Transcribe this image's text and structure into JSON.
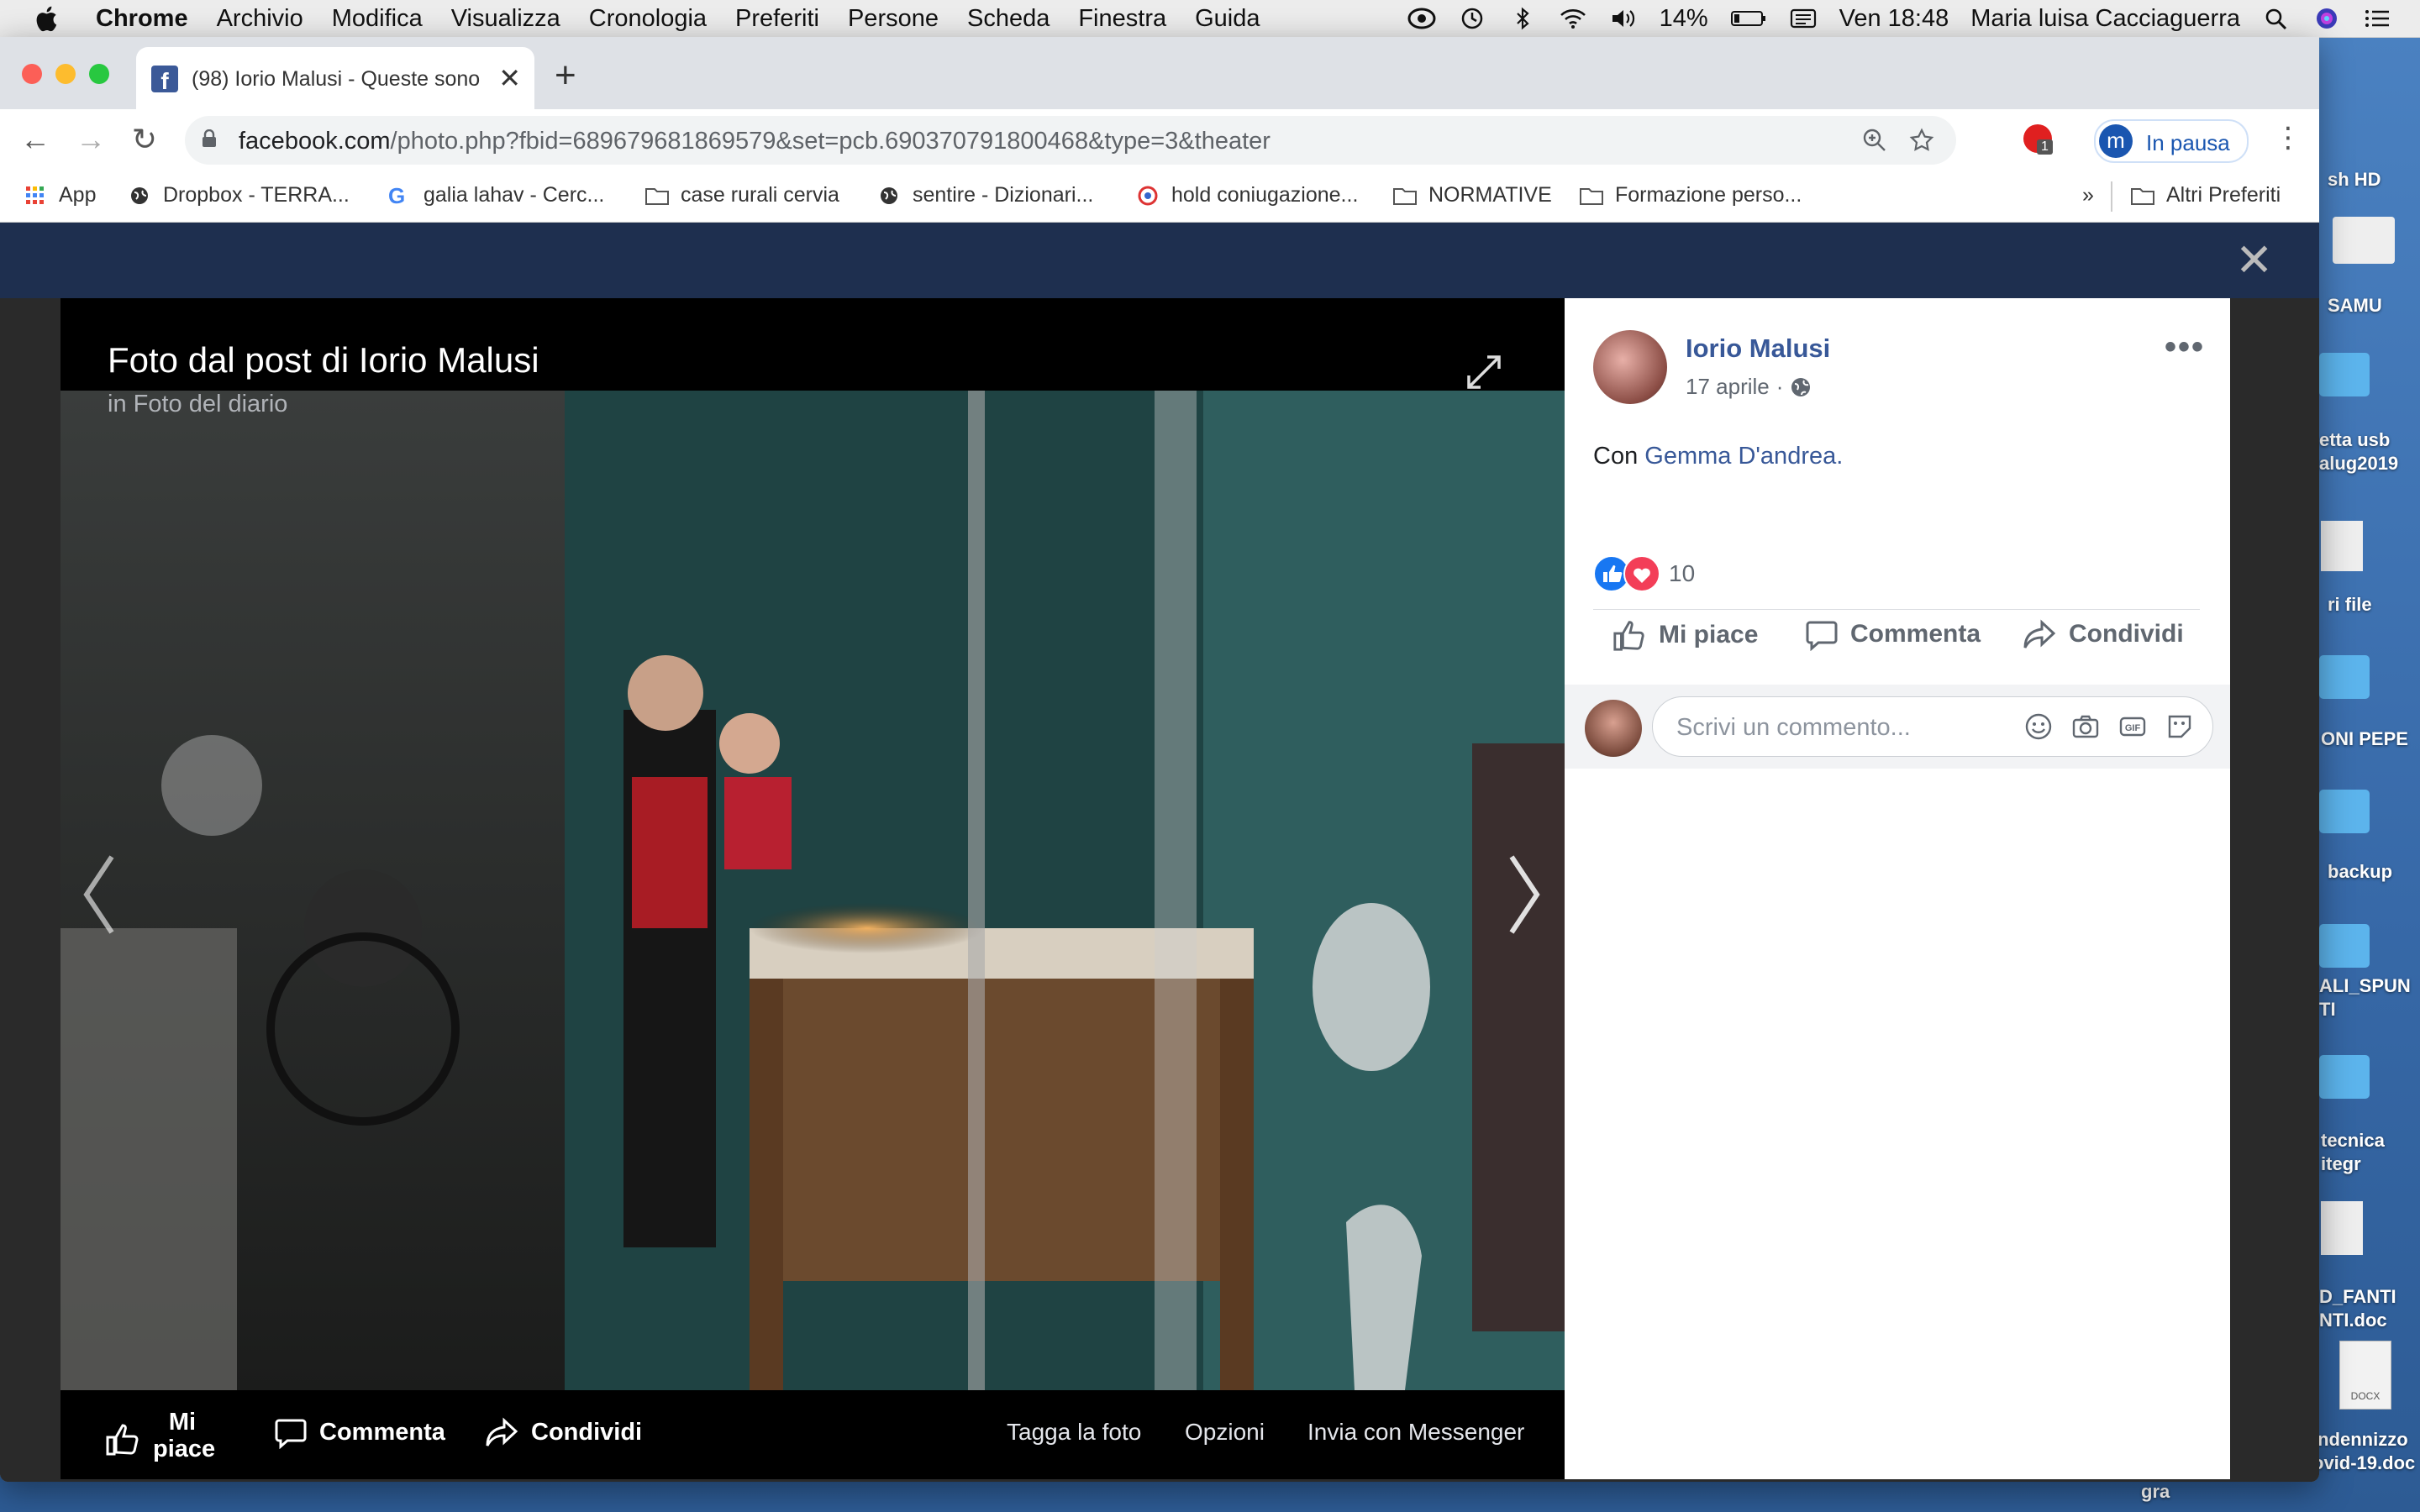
{
  "menubar": {
    "app": "Chrome",
    "items": [
      "Archivio",
      "Modifica",
      "Visualizza",
      "Cronologia",
      "Preferiti",
      "Persone",
      "Scheda",
      "Finestra",
      "Guida"
    ],
    "battery": "14%",
    "clock": "Ven 18:48",
    "user": "Maria luisa Cacciaguerra"
  },
  "desktop": {
    "icons": [
      "sh HD",
      "SAMU",
      "etta usb\nalug2019",
      "ri file",
      "ONI PEPE",
      "backup",
      "ALI_SPUN\nTI",
      "tecnica\nitegr",
      "D_FANTI\nNTI.doc",
      "Indennizzo\novid-19.doc"
    ],
    "bottom_text": "gra"
  },
  "browser": {
    "tab_title": "(98) Iorio Malusi - Queste sono",
    "url_host": "facebook.com",
    "url_path": "/photo.php?fbid=689679681869579&set=pcb.690370791800468&type=3&theater",
    "profile_label": "In pausa",
    "profile_initial": "m",
    "extension_badge": "1",
    "bookmarks": [
      "App",
      "Dropbox - TERRA...",
      "galia lahav - Cerc...",
      "case rurali cervia",
      "sentire - Dizionari...",
      "hold coniugazione...",
      "NORMATIVE",
      "Formazione perso..."
    ],
    "bookmarks_more": "»",
    "other_bookmarks": "Altri Preferiti"
  },
  "viewer": {
    "title": "Foto dal post di Iorio Malusi",
    "in_prefix": "in",
    "album": "Foto del diario",
    "actions": {
      "like": "Mi piace",
      "comment": "Commenta",
      "share": "Condividi",
      "tag": "Tagga la foto",
      "options": "Opzioni",
      "send": "Invia con Messenger"
    }
  },
  "post": {
    "author": "Iorio Malusi",
    "date": "17 aprile",
    "with_prefix": "Con",
    "with_name": "Gemma D'andrea",
    "reaction_count": "10",
    "like_label": "Mi piace",
    "comment_label": "Commenta",
    "share_label": "Condividi",
    "comment_placeholder": "Scrivi un commento..."
  },
  "colors": {
    "facebook_blue": "#385898",
    "like_blue": "#1877f2",
    "love_red": "#f33e58"
  }
}
